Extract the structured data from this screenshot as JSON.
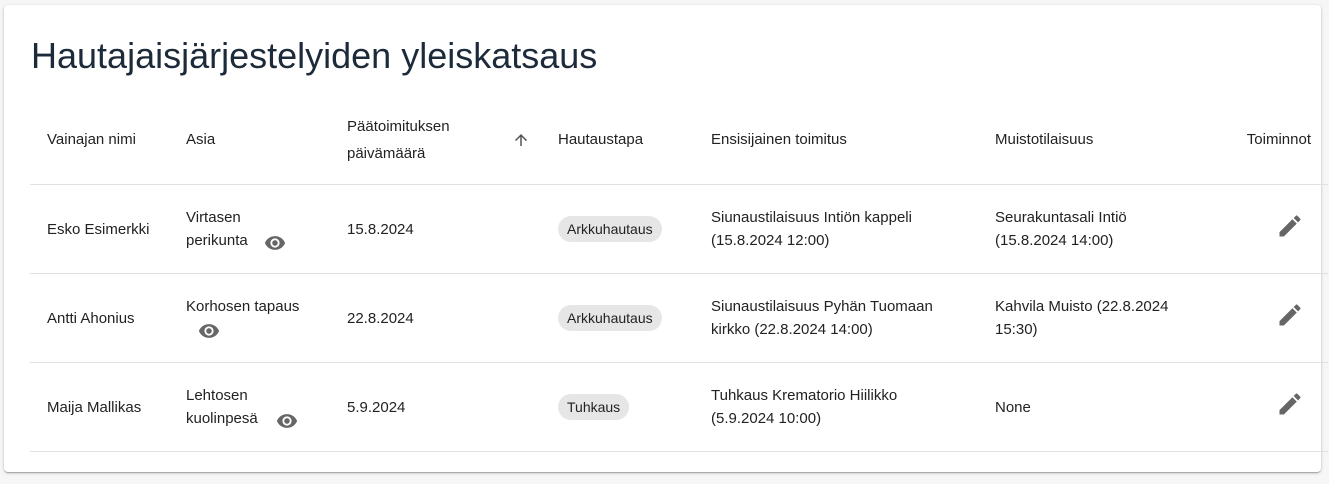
{
  "page": {
    "title": "Hautajaisjärjestelyiden yleiskatsaus"
  },
  "table": {
    "headers": {
      "name": "Vainajan nimi",
      "asia": "Asia",
      "date": "Päätoimituksen päivämäärä",
      "type": "Hautaustapa",
      "main": "Ensisijainen toimitus",
      "memorial": "Muistotilaisuus",
      "actions": "Toiminnot"
    },
    "sort": {
      "column": "date",
      "direction": "ascending",
      "icon": "arrow-upward-icon"
    },
    "rows": [
      {
        "name": "Esko Esimerkki",
        "asia": "Virtasen perikunta",
        "date": "15.8.2024",
        "type": "Arkkuhautaus",
        "main": "Siunaustilaisuus Intiön kappeli (15.8.2024 12:00)",
        "memorial": "Seurakuntasali Intiö (15.8.2024 14:00)"
      },
      {
        "name": "Antti Ahonius",
        "asia": "Korhosen tapaus",
        "date": "22.8.2024",
        "type": "Arkkuhautaus",
        "main": "Siunaustilaisuus Pyhän Tuomaan kirkko (22.8.2024 14:00)",
        "memorial": "Kahvila Muisto (22.8.2024 15:30)"
      },
      {
        "name": "Maija Mallikas",
        "asia": "Lehtosen kuolinpesä",
        "date": "5.9.2024",
        "type": "Tuhkaus",
        "main": "Tuhkaus Krematorio Hiilikko (5.9.2024 10:00)",
        "memorial": "None"
      }
    ],
    "row_icons": {
      "view": "eye-icon",
      "edit": "pencil-edit-icon"
    }
  },
  "colors": {
    "title": "#1c2a3a",
    "chip_background": "#e6e6e6",
    "icon": "#666666",
    "divider": "#e0e0e0"
  }
}
